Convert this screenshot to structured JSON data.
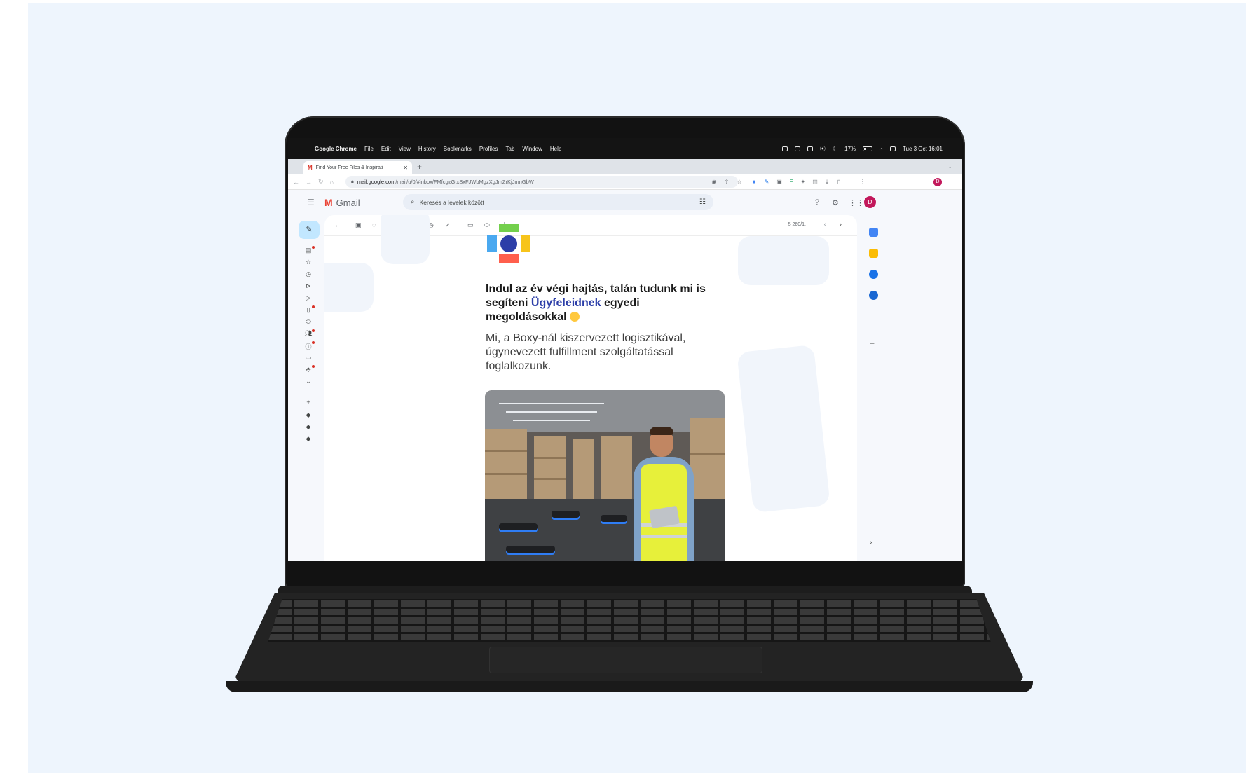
{
  "menubar": {
    "app_name": "Google Chrome",
    "items": [
      "File",
      "Edit",
      "View",
      "History",
      "Bookmarks",
      "Profiles",
      "Tab",
      "Window",
      "Help"
    ],
    "battery": "17%",
    "clock": "Tue 3 Oct  16:01"
  },
  "browser": {
    "tab_title": "Find Your Free Files & Inspirati",
    "url_host": "mail.google.com",
    "url_path": "/mail/u/0/#inbox/FMfcgzGtxSxFJWbMgzXgJmZrKjJmnGbW",
    "profile_initial": "D"
  },
  "gmail": {
    "brand": "Gmail",
    "search_placeholder": "Keresés a levelek között",
    "avatar_initial": "D",
    "pager": "5 260/1."
  },
  "email": {
    "headline_part1": "Indul az év végi hajtás, talán tudunk mi is segíteni",
    "headline_accent": "Ügyfeleidnek",
    "headline_part2": "egyedi megoldásokkal",
    "intro": "Mi, a Boxy-nál kiszervezett logisztikával, úgynevezett fulfillment szolgáltatással foglalkozunk."
  },
  "colors": {
    "gmail_red": "#ea4335",
    "compose_blue": "#c2e7ff",
    "brand_navy": "#2c3ea8",
    "logo_green": "#73d04c",
    "logo_blue": "#4aa9f0",
    "logo_yellow": "#f7c41b",
    "logo_red": "#ff5f4d",
    "vest_yellow": "#e7f03a"
  },
  "icons": [
    "apple-icon",
    "hamburger-icon",
    "search-icon",
    "filter-icon",
    "help-icon",
    "settings-icon",
    "apps-icon",
    "back-arrow-icon",
    "archive-icon",
    "report-icon",
    "trash-icon",
    "mark-unread-icon",
    "snooze-icon",
    "add-task-icon",
    "move-icon",
    "label-icon",
    "more-icon",
    "calendar-icon",
    "keep-icon",
    "tasks-icon",
    "contacts-icon"
  ]
}
